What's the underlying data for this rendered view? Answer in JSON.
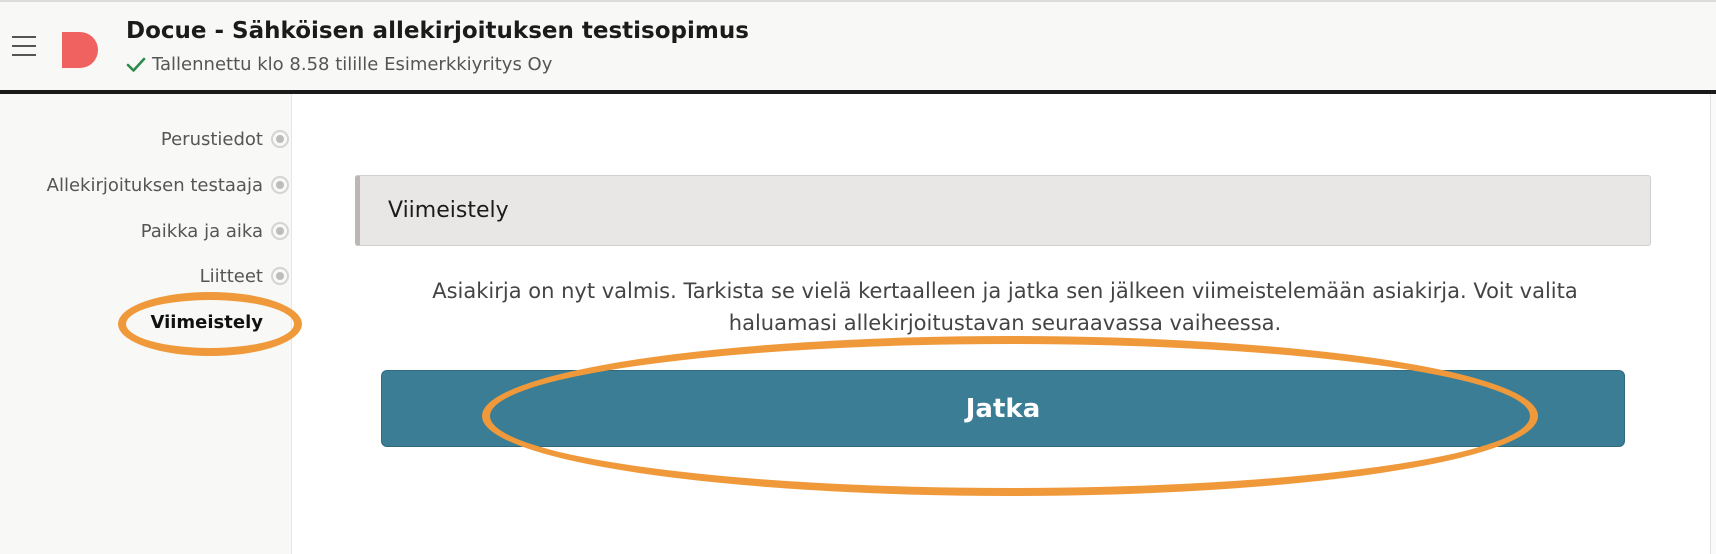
{
  "header": {
    "title": "Docue - Sähköisen allekirjoituksen testisopimus",
    "status": "Tallennettu klo 8.58 tilille Esimerkkiyritys Oy",
    "menu_icon": "hamburger-menu-icon",
    "logo_icon": "docue-logo",
    "status_icon": "check-icon",
    "brand_color": "#ef625f",
    "check_color": "#2f8a4c"
  },
  "sidebar": {
    "steps": [
      {
        "label": "Perustiedot",
        "active": false
      },
      {
        "label": "Allekirjoituksen testaaja",
        "active": false
      },
      {
        "label": "Paikka ja aika",
        "active": false
      },
      {
        "label": "Liitteet",
        "active": false
      },
      {
        "label": "Viimeistely",
        "active": true
      }
    ]
  },
  "main": {
    "section_title": "Viimeistely",
    "description": "Asiakirja on nyt valmis. Tarkista se vielä kertaalleen ja jatka sen jälkeen viimeistelemään asiakirja. Voit valita haluamasi allekirjoitustavan seuraavassa vaiheessa.",
    "continue_label": "Jatka",
    "button_color": "#3a7d95",
    "highlight_color": "#f0993a"
  }
}
